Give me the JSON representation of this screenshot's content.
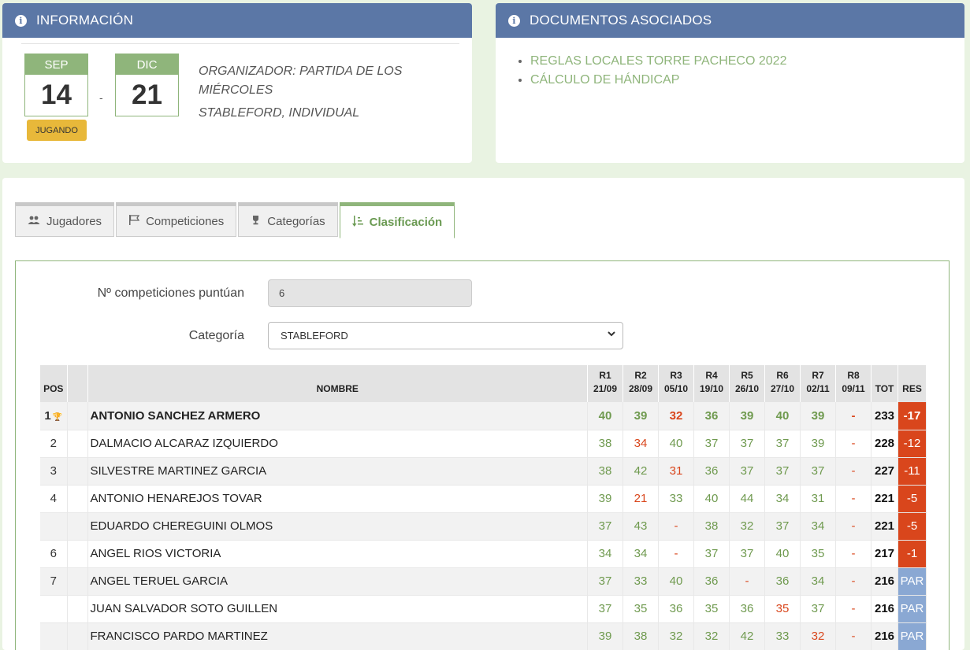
{
  "info_panel": {
    "title": "INFORMACIÓN",
    "start": {
      "month": "SEP",
      "day": "14"
    },
    "end": {
      "month": "DIC",
      "day": "21"
    },
    "separator": "-",
    "status": "JUGANDO",
    "organizer": "ORGANIZADOR: PARTIDA DE LOS MIÉRCOLES",
    "type": "STABLEFORD, INDIVIDUAL"
  },
  "docs_panel": {
    "title": "DOCUMENTOS ASOCIADOS",
    "items": [
      "REGLAS LOCALES TORRE PACHECO 2022",
      "CÁLCULO DE HÁNDICAP"
    ]
  },
  "tabs": [
    {
      "label": "Jugadores",
      "icon": "users-icon"
    },
    {
      "label": "Competiciones",
      "icon": "flag-icon"
    },
    {
      "label": "Categorías",
      "icon": "trophy-icon"
    },
    {
      "label": "Clasificación",
      "icon": "sort-icon",
      "active": true
    }
  ],
  "form": {
    "comp_label": "Nº competiciones puntúan",
    "comp_value": "6",
    "cat_label": "Categoría",
    "cat_value": "STABLEFORD"
  },
  "table": {
    "headers": {
      "pos": "POS",
      "name": "NOMBRE",
      "rounds": [
        {
          "r": "R1",
          "d": "21/09"
        },
        {
          "r": "R2",
          "d": "28/09"
        },
        {
          "r": "R3",
          "d": "05/10"
        },
        {
          "r": "R4",
          "d": "19/10"
        },
        {
          "r": "R5",
          "d": "26/10"
        },
        {
          "r": "R6",
          "d": "27/10"
        },
        {
          "r": "R7",
          "d": "02/11"
        },
        {
          "r": "R8",
          "d": "09/11"
        }
      ],
      "tot": "TOT",
      "res": "RES"
    },
    "rows": [
      {
        "pos": "1",
        "name": "ANTONIO SANCHEZ ARMERO",
        "scores": [
          "40",
          "39",
          "32",
          "36",
          "39",
          "40",
          "39",
          "-"
        ],
        "red": [
          2,
          7
        ],
        "tot": "233",
        "res": "-17",
        "res_type": "neg"
      },
      {
        "pos": "2",
        "name": "DALMACIO ALCARAZ IZQUIERDO",
        "scores": [
          "38",
          "34",
          "40",
          "37",
          "37",
          "37",
          "39",
          "-"
        ],
        "red": [
          1,
          7
        ],
        "tot": "228",
        "res": "-12",
        "res_type": "neg"
      },
      {
        "pos": "3",
        "name": "SILVESTRE MARTINEZ GARCIA",
        "scores": [
          "38",
          "42",
          "31",
          "36",
          "37",
          "37",
          "37",
          "-"
        ],
        "red": [
          2,
          7
        ],
        "tot": "227",
        "res": "-11",
        "res_type": "neg"
      },
      {
        "pos": "4",
        "name": "ANTONIO HENAREJOS TOVAR",
        "scores": [
          "39",
          "21",
          "33",
          "40",
          "44",
          "34",
          "31",
          "-"
        ],
        "red": [
          1,
          7
        ],
        "tot": "221",
        "res": "-5",
        "res_type": "neg"
      },
      {
        "pos": "",
        "name": "EDUARDO CHEREGUINI OLMOS",
        "scores": [
          "37",
          "43",
          "-",
          "38",
          "32",
          "37",
          "34",
          "-"
        ],
        "red": [
          2,
          7
        ],
        "tot": "221",
        "res": "-5",
        "res_type": "neg"
      },
      {
        "pos": "6",
        "name": "ANGEL RIOS VICTORIA",
        "scores": [
          "34",
          "34",
          "-",
          "37",
          "37",
          "40",
          "35",
          "-"
        ],
        "red": [
          2,
          7
        ],
        "tot": "217",
        "res": "-1",
        "res_type": "neg"
      },
      {
        "pos": "7",
        "name": "ANGEL TERUEL GARCIA",
        "scores": [
          "37",
          "33",
          "40",
          "36",
          "-",
          "36",
          "34",
          "-"
        ],
        "red": [
          4,
          7
        ],
        "tot": "216",
        "res": "PAR",
        "res_type": "par"
      },
      {
        "pos": "",
        "name": "JUAN SALVADOR SOTO GUILLEN",
        "scores": [
          "37",
          "35",
          "36",
          "35",
          "36",
          "35",
          "37",
          "-"
        ],
        "red": [
          5,
          7
        ],
        "tot": "216",
        "res": "PAR",
        "res_type": "par"
      },
      {
        "pos": "",
        "name": "FRANCISCO PARDO MARTINEZ",
        "scores": [
          "39",
          "38",
          "32",
          "32",
          "42",
          "33",
          "32",
          "-"
        ],
        "red": [
          6,
          7
        ],
        "tot": "216",
        "res": "PAR",
        "res_type": "par"
      }
    ]
  }
}
